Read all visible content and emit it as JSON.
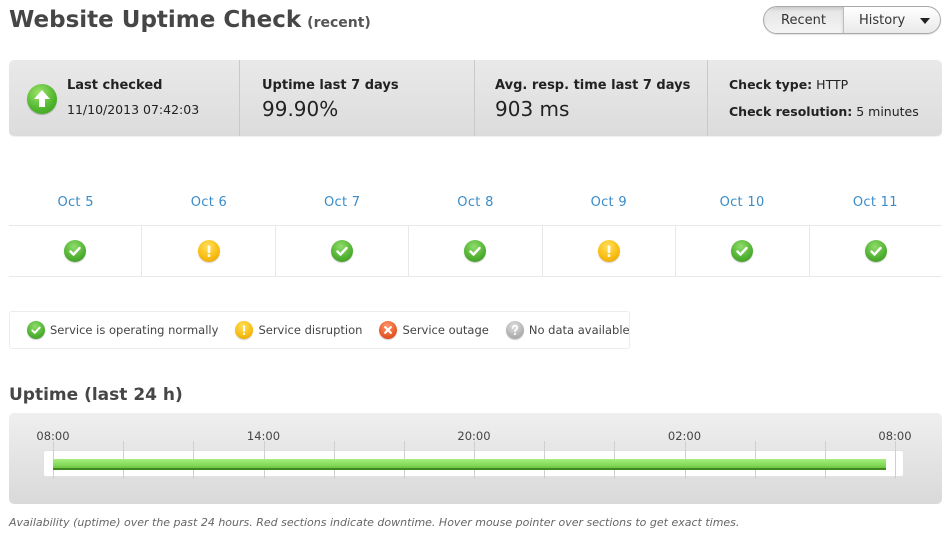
{
  "header": {
    "title": "Website Uptime Check",
    "subtitle": "(recent)",
    "view_toggle": {
      "options": [
        "Recent",
        "History"
      ],
      "selected": "Recent",
      "dropdown_icon": "caret-down-icon"
    }
  },
  "stats": {
    "last_checked": {
      "icon": "arrow-up-icon",
      "label": "Last checked",
      "value": "11/10/2013 07:42:03"
    },
    "uptime_7d": {
      "label": "Uptime last 7 days",
      "value": "99.90%"
    },
    "avg_response_7d": {
      "label": "Avg. resp. time last 7 days",
      "value": "903 ms"
    },
    "check_info": {
      "type_label": "Check type:",
      "type_value": "HTTP",
      "resolution_label": "Check resolution:",
      "resolution_value": "5 minutes"
    }
  },
  "daily_status": [
    {
      "date": "Oct 5",
      "status": "ok"
    },
    {
      "date": "Oct 6",
      "status": "disruption"
    },
    {
      "date": "Oct 7",
      "status": "ok"
    },
    {
      "date": "Oct 8",
      "status": "ok"
    },
    {
      "date": "Oct 9",
      "status": "disruption"
    },
    {
      "date": "Oct 10",
      "status": "ok"
    },
    {
      "date": "Oct 11",
      "status": "ok"
    }
  ],
  "legend": [
    {
      "status": "ok",
      "icon": "check-circle-icon",
      "label": "Service is operating normally"
    },
    {
      "status": "disruption",
      "icon": "warning-circle-icon",
      "label": "Service disruption"
    },
    {
      "status": "outage",
      "icon": "x-circle-icon",
      "label": "Service outage"
    },
    {
      "status": "nodata",
      "icon": "question-circle-icon",
      "label": "No data available"
    }
  ],
  "uptime_24h": {
    "title": "Uptime (last 24 h)",
    "time_labels": [
      "08:00",
      "14:00",
      "20:00",
      "02:00",
      "08:00"
    ],
    "hours_span": 24,
    "segments": [
      {
        "status": "up",
        "start_hour": 0,
        "end_hour": 23.75
      }
    ],
    "footnote": "Availability (uptime) over the past 24 hours. Red sections indicate downtime. Hover mouse pointer over sections to get exact times."
  },
  "colors": {
    "date_link": "#3a8cc8",
    "ok": "#4fb031",
    "disruption": "#f8bb10",
    "outage": "#e85a2a",
    "nodata": "#b3b3b3",
    "uptime_bar": "#86dc5c"
  }
}
